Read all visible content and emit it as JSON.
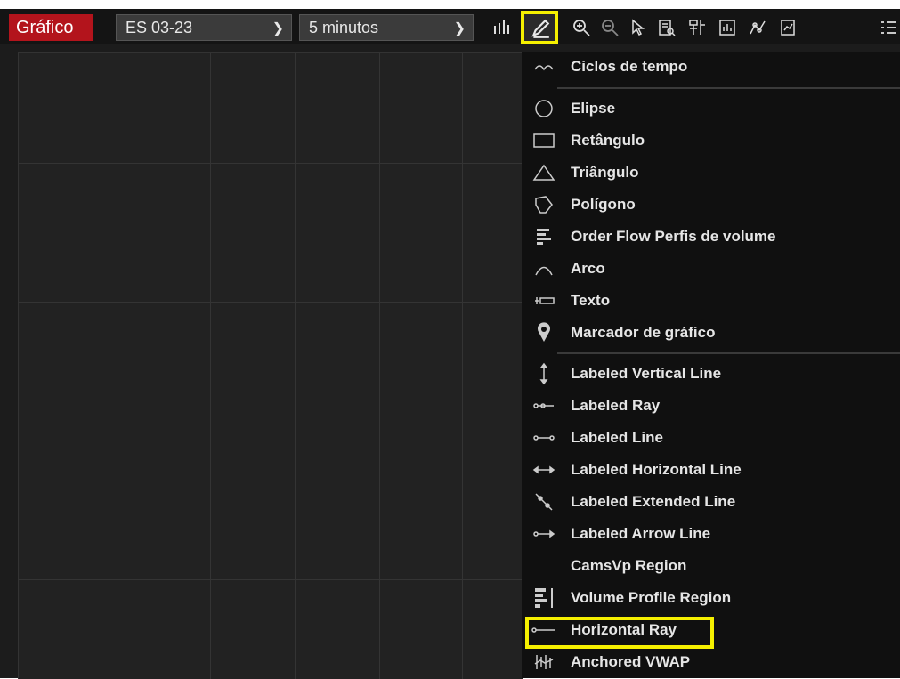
{
  "toolbar": {
    "title_tab": "Gráfico",
    "symbol_select": "ES 03-23",
    "interval_select": "5 minutos"
  },
  "icons": {
    "bar_type": "bar-chart-icon",
    "draw": "pencil-icon",
    "zoom_in": "zoom-in-icon",
    "zoom_out": "zoom-out-icon",
    "pointer": "cursor-icon",
    "data_box": "document-search-icon",
    "dom": "ladder-icon",
    "studies": "indicators-icon",
    "analysis": "line-graph-icon",
    "report": "report-icon",
    "more": "list-icon"
  },
  "menu": {
    "items": [
      {
        "label": "Ciclos de tempo",
        "icon": "wave-icon"
      },
      {
        "label": "Elipse",
        "icon": "circle-icon"
      },
      {
        "label": "Retângulo",
        "icon": "rectangle-icon"
      },
      {
        "label": "Triângulo",
        "icon": "triangle-icon"
      },
      {
        "label": "Polígono",
        "icon": "polygon-icon"
      },
      {
        "label": "Order Flow Perfis de volume",
        "icon": "volume-profile-icon"
      },
      {
        "label": "Arco",
        "icon": "arc-icon"
      },
      {
        "label": "Texto",
        "icon": "text-icon"
      },
      {
        "label": "Marcador de gráfico",
        "icon": "map-pin-icon"
      },
      {
        "label": "Labeled Vertical Line",
        "icon": "vertical-line-icon"
      },
      {
        "label": "Labeled Ray",
        "icon": "ray-icon"
      },
      {
        "label": "Labeled Line",
        "icon": "line-icon"
      },
      {
        "label": "Labeled Horizontal Line",
        "icon": "horizontal-line-icon"
      },
      {
        "label": "Labeled Extended Line",
        "icon": "extended-line-icon"
      },
      {
        "label": "Labeled Arrow Line",
        "icon": "arrow-line-icon"
      },
      {
        "label": "CamsVp Region",
        "icon": ""
      },
      {
        "label": "Volume Profile Region",
        "icon": "volume-region-icon"
      },
      {
        "label": "Horizontal Ray",
        "icon": "horizontal-ray-icon"
      },
      {
        "label": "Anchored VWAP",
        "icon": "vwap-icon"
      }
    ]
  },
  "colors": {
    "title_tab_bg": "#b3141c",
    "highlight": "#f5f000",
    "menu_bg": "#101010",
    "chart_bg": "#222222"
  }
}
